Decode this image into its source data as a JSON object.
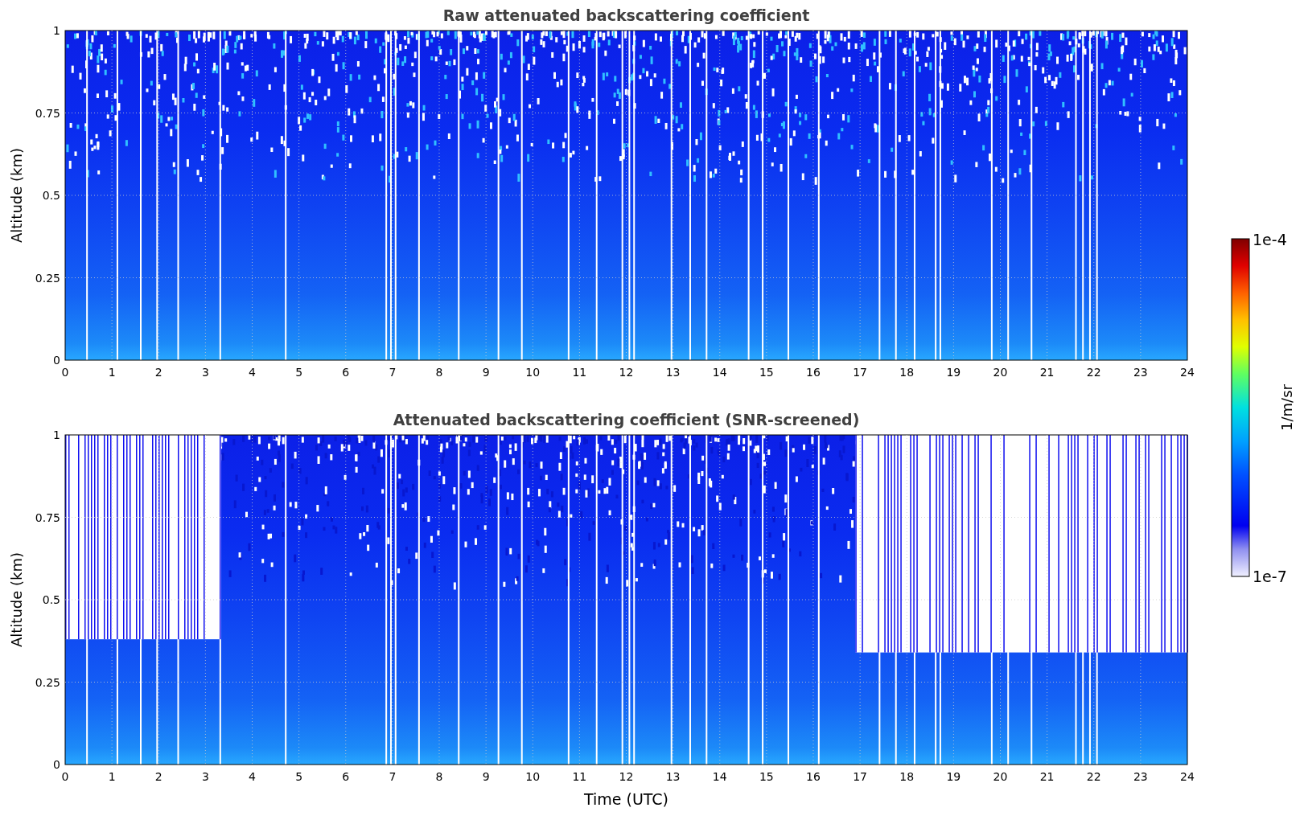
{
  "panels": [
    {
      "kind": "raw",
      "title": "Raw attenuated backscattering coefficient",
      "ylabel": "Altitude (km)",
      "yticks": [
        "1",
        "0.75",
        "0.5",
        "0.25",
        "0"
      ],
      "xticks": [
        "0",
        "1",
        "2",
        "3",
        "4",
        "5",
        "6",
        "7",
        "8",
        "9",
        "10",
        "11",
        "12",
        "13",
        "14",
        "15",
        "16",
        "17",
        "18",
        "19",
        "20",
        "21",
        "22",
        "23",
        "24"
      ]
    },
    {
      "kind": "screened",
      "title": "Attenuated backscattering coefficient (SNR-screened)",
      "ylabel": "Altitude (km)",
      "yticks": [
        "1",
        "0.75",
        "0.5",
        "0.25",
        "0"
      ],
      "xticks": [
        "0",
        "1",
        "2",
        "3",
        "4",
        "5",
        "6",
        "7",
        "8",
        "9",
        "10",
        "11",
        "12",
        "13",
        "14",
        "15",
        "16",
        "17",
        "18",
        "19",
        "20",
        "21",
        "22",
        "23",
        "24"
      ],
      "xlabel": "Time (UTC)"
    }
  ],
  "colorbar": {
    "max_label": "1e-4",
    "min_label": "1e-7",
    "label": "1/m/sr"
  }
}
